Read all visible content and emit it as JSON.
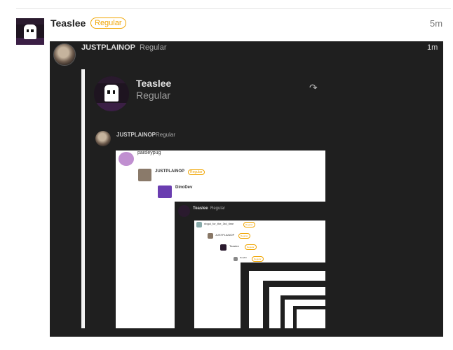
{
  "post": {
    "username": "Teaslee",
    "role_badge": "Regular",
    "time": "5m",
    "accent": "#f0a400"
  },
  "screenshot": {
    "author": "JUSTPLAINOP",
    "role": "Regular",
    "time": "1m",
    "quote": {
      "username": "Teaslee",
      "role": "Regular",
      "share_icon": "share-icon"
    },
    "nested_post": {
      "author": "JUSTPLAINOP",
      "role": "Regular"
    },
    "nested_embed": {
      "user1": "paisleypug",
      "user2": "JUSTPLAINOP",
      "user2_badge": "Regular",
      "user3": "DinoDev",
      "inner_user": "Teaslee",
      "inner_role": "Regular",
      "deep_user1": "nbgoi_for_the_3rd_time",
      "deep_user1_badge": "Regular",
      "deep_user2": "JUSTPLAINOP",
      "deep_user2_badge": "Regular",
      "deep_user3": "Teaslee",
      "deep_user3_badge": "Regular",
      "deep_user4": "Noodbr",
      "deep_user4_badge": "Regular"
    }
  }
}
